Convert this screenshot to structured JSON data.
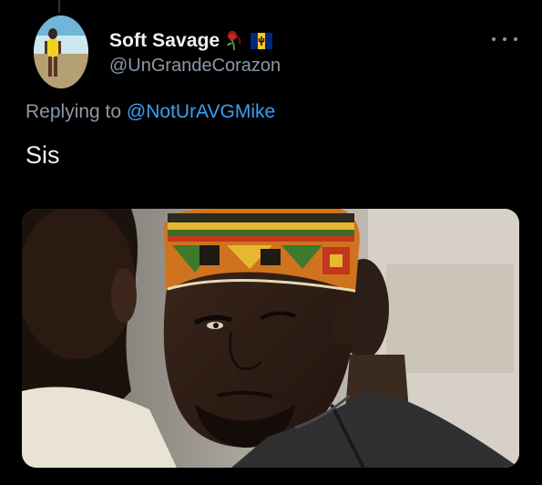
{
  "tweet": {
    "display_name": "Soft Savage",
    "handle": "@UnGrandeCorazon",
    "reply_prefix": "Replying to",
    "reply_mention": "@NotUrAVGMike",
    "text": "Sis",
    "name_emojis": [
      "wilted-rose-icon",
      "barbados-flag-icon"
    ]
  },
  "icons": {
    "more": "more-horizontal-icon"
  },
  "media": {
    "type": "photo",
    "description_icon": "reaction-meme-photo"
  },
  "colors": {
    "background": "#000000",
    "name": "#f2f2f2",
    "secondary": "#8b98a5",
    "link": "#3d9df0",
    "body": "#f0f0f0"
  }
}
